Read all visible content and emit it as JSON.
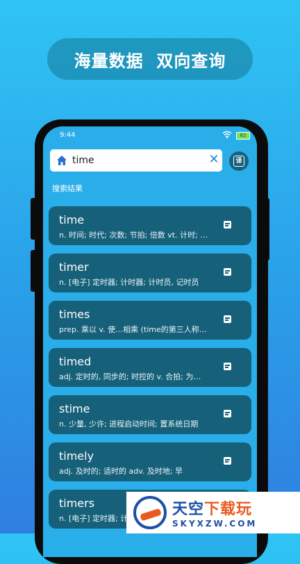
{
  "banner": {
    "title": "海量数据  双向查询"
  },
  "status": {
    "time": "9:44",
    "battery": "82"
  },
  "search": {
    "query": "time"
  },
  "results_label": "搜索结果",
  "results": [
    {
      "word": "time",
      "def": "n. 时间; 时代; 次数; 节拍; 倍数 vt. 计时; 测时; 为…安排时间"
    },
    {
      "word": "timer",
      "def": "n. [电子] 定时器; 计时器; 计时员, 记时员"
    },
    {
      "word": "times",
      "def": "prep. 乘以 v. 使…相乘 (time的第三人称单数)"
    },
    {
      "word": "timed",
      "def": "adj. 定时的, 同步的; 时控的 v. 合拍; 为…安排时间"
    },
    {
      "word": "stime",
      "def": "n. 少量, 少许; 进程启动时间; 置系统日期"
    },
    {
      "word": "timely",
      "def": "adj. 及时的; 适时的 adv. 及时地; 早"
    },
    {
      "word": "timers",
      "def": "n. [电子] 定时器; 计时器"
    }
  ],
  "watermark": {
    "main1": "天空",
    "main2": "下载玩",
    "sub": "SKYXZW.COM"
  },
  "colors": {
    "card": "#17607a",
    "accent": "#2a7fd6"
  }
}
